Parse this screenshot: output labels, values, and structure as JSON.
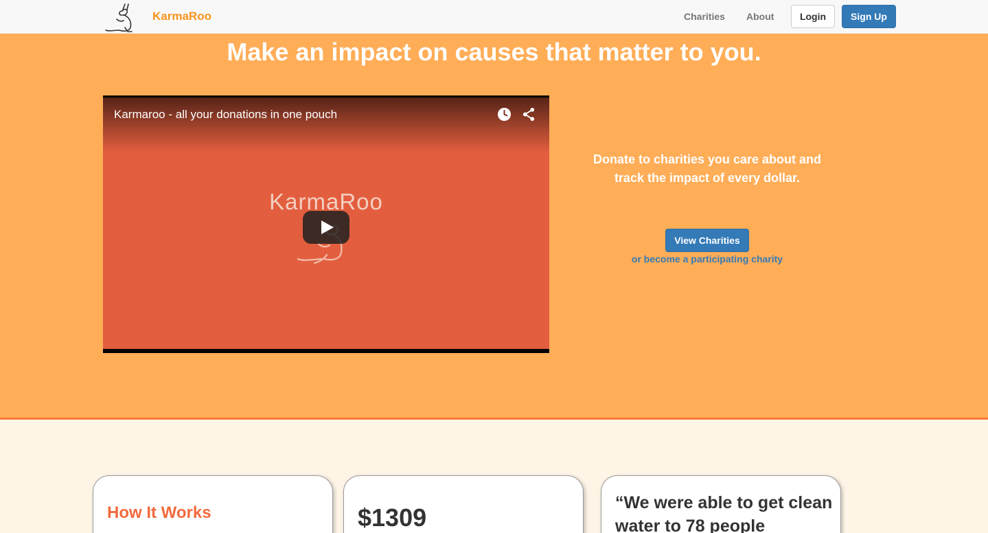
{
  "navbar": {
    "brand": "KarmaRoo",
    "links": [
      "Charities",
      "About"
    ],
    "login_label": "Login",
    "signup_label": "Sign Up"
  },
  "hero": {
    "title": "Make an impact on causes that matter to you.",
    "video": {
      "title": "Karmaroo - all your donations in one pouch",
      "logo_text": "KarmaRoo"
    },
    "tagline": "Donate to charities you care about and track the impact of every dollar.",
    "view_button": "View Charities",
    "become_link": "or become a participating charity"
  },
  "cards": {
    "how_title": "How It Works",
    "amount": "$1309",
    "quote": "“We were able to get clean water to 78 people"
  },
  "colors": {
    "hero_bg": "#ffad57",
    "brand": "#f7941d",
    "primary": "#337ab7",
    "page_bg": "#fef5e7",
    "accent": "#f26a3d"
  }
}
